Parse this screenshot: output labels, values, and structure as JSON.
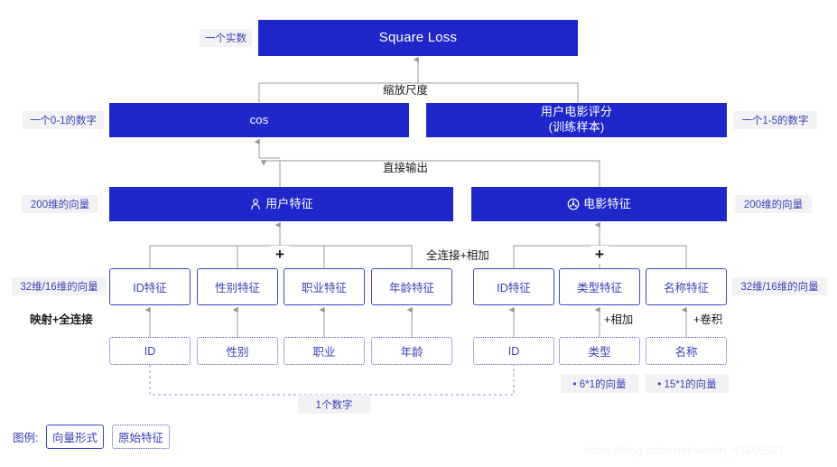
{
  "colors": {
    "box_fill": "#1f27ca",
    "box_text": "#ffffff",
    "vector_border": "#3b49c4",
    "raw_border": "#4a56c8",
    "accent_text": "#3b3fb5",
    "chip_bg": "#f2f2f5",
    "wire": "#9a9a9a",
    "page_bg": "#ffffff"
  },
  "loss": {
    "title": "Square Loss",
    "side_label": "一个实数"
  },
  "level2": {
    "cos": {
      "label": "cos",
      "side_label": "一个0-1的数字"
    },
    "rating": {
      "line1": "用户电影评分",
      "line2": "(训练样本)",
      "side_label": "一个1-5的数字"
    },
    "edge_label": "缩放尺度"
  },
  "level3": {
    "user": {
      "label": "用户特征",
      "icon": "user-icon",
      "side_label": "200维的向量"
    },
    "movie": {
      "label": "电影特征",
      "icon": "film-reel-icon",
      "side_label": "200维的向量"
    },
    "edge_label": "直接输出"
  },
  "level4": {
    "edge_label": "全连接+相加",
    "plus_symbol": "+",
    "user_side_label": "32维/16维的向量",
    "movie_side_label": "32维/16维的向量",
    "user_features": [
      "ID特征",
      "性别特征",
      "职业特征",
      "年龄特征"
    ],
    "movie_features": [
      "ID特征",
      "类型特征",
      "名称特征"
    ]
  },
  "level5": {
    "left_edge_label": "映射+全连接",
    "movie_edge_labels": [
      "+相加",
      "+卷积"
    ],
    "user_raw": [
      "ID",
      "性别",
      "职业",
      "年龄"
    ],
    "movie_raw": [
      "ID",
      "类型",
      "名称"
    ],
    "shared_label": "1个数字",
    "movie_vector_labels": [
      "• 6*1的向量",
      "• 15*1的向量"
    ]
  },
  "legend": {
    "title": "图例:",
    "vector_form": "向量形式",
    "raw_feature": "原始特征"
  },
  "watermark": "https://blog.csdn.net/weixin_41605937"
}
